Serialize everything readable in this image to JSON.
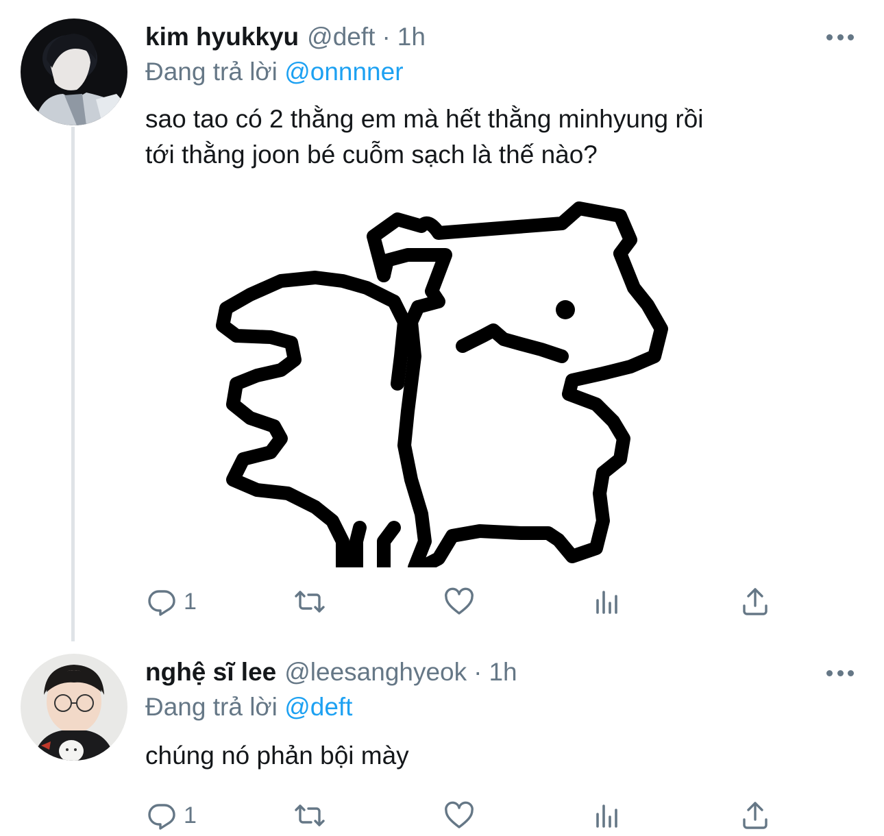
{
  "tweets": [
    {
      "name": "kim hyukkyu",
      "handle": "@deft",
      "separator": "·",
      "time": "1h",
      "replying_prefix": "Đang trả lời",
      "replying_to": "@onnnner",
      "text_lines": [
        "sao tao có 2 thằng em mà hết thằng minhyung rồi",
        "tới thằng joon bé cuỗm sạch là thế nào?"
      ],
      "has_media": true,
      "reply_count": "1"
    },
    {
      "name": "nghệ sĩ lee",
      "handle": "@leesanghyeok",
      "separator": "·",
      "time": "1h",
      "replying_prefix": "Đang trả lời",
      "replying_to": "@deft",
      "text_lines": [
        "chúng nó phản bội mày"
      ],
      "has_media": false,
      "reply_count": "1"
    }
  ],
  "icons": {
    "reply": "reply-icon",
    "retweet": "retweet-icon",
    "like": "heart-icon",
    "stats": "analytics-icon",
    "share": "share-icon",
    "more": "more-icon"
  },
  "colors": {
    "link": "#1da1f2",
    "secondary_text": "#657786",
    "primary_text": "#14171a",
    "thread_line": "#dfe3e7"
  }
}
